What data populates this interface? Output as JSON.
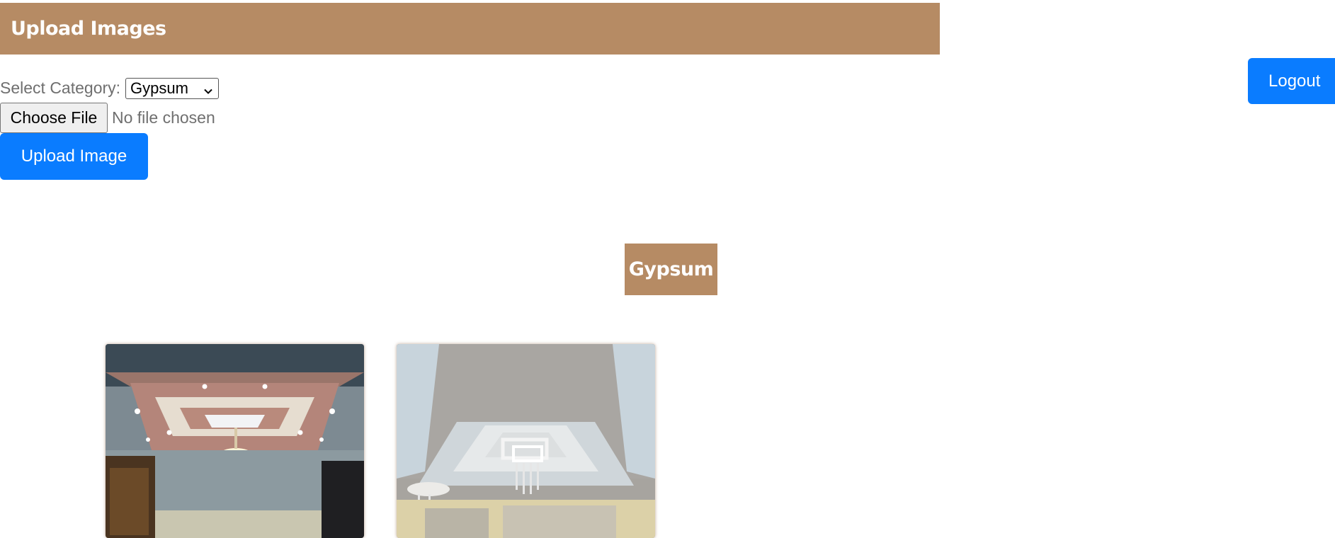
{
  "header": {
    "title": "Upload Images"
  },
  "logout": {
    "label": "Logout"
  },
  "form": {
    "category_label": "Select Category:",
    "category_selected": "Gypsum",
    "file_button_label": "Choose File",
    "file_status": "No file chosen",
    "upload_label": "Upload Image"
  },
  "gallery": {
    "category_title": "Gypsum",
    "image_count": 2
  },
  "colors": {
    "brand_tan": "#b68b64",
    "primary_blue": "#0a7cff"
  }
}
